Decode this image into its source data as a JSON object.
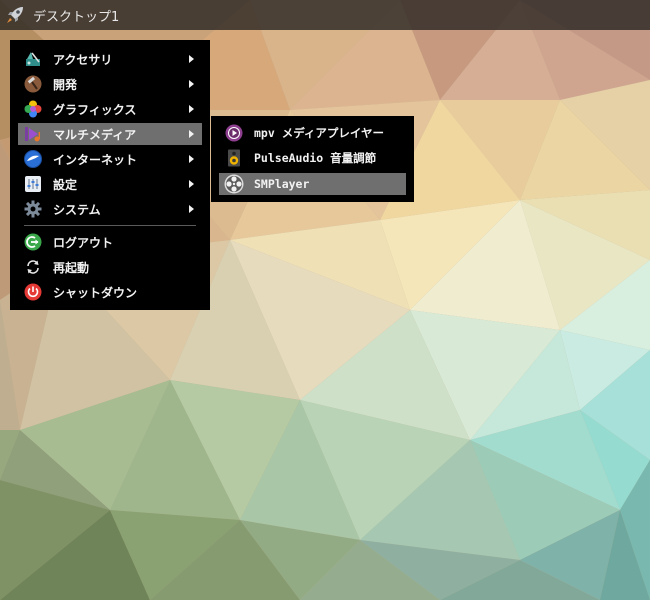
{
  "panel": {
    "launcher_icon": "rocket-icon",
    "desktop_label": "デスクトップ1"
  },
  "main_menu": {
    "items": [
      {
        "label": "アクセサリ",
        "icon": "accessories-icon",
        "has_submenu": true
      },
      {
        "label": "開発",
        "icon": "development-hammer-icon",
        "has_submenu": true
      },
      {
        "label": "グラフィックス",
        "icon": "graphics-icon",
        "has_submenu": true
      },
      {
        "label": "マルチメディア",
        "icon": "multimedia-icon",
        "has_submenu": true,
        "active": true
      },
      {
        "label": "インターネット",
        "icon": "internet-globe-icon",
        "has_submenu": true
      },
      {
        "label": "設定",
        "icon": "settings-sliders-icon",
        "has_submenu": true
      },
      {
        "label": "システム",
        "icon": "system-gear-icon",
        "has_submenu": true
      }
    ],
    "session_items": [
      {
        "label": "ログアウト",
        "icon": "logout-icon"
      },
      {
        "label": "再起動",
        "icon": "restart-icon"
      },
      {
        "label": "シャットダウン",
        "icon": "shutdown-icon"
      }
    ]
  },
  "sub_menu": {
    "items": [
      {
        "label": "mpv メディアプレイヤー",
        "icon": "mpv-icon"
      },
      {
        "label": "PulseAudio 音量調節",
        "icon": "speaker-icon"
      },
      {
        "label": "SMPlayer",
        "icon": "smplayer-film-reel-icon",
        "active": true
      }
    ]
  },
  "colors": {
    "menu_bg": "#000000",
    "menu_highlight": "#6f6f6f",
    "menu_text": "#f2f2f2",
    "panel_bg": "#2d2824"
  }
}
